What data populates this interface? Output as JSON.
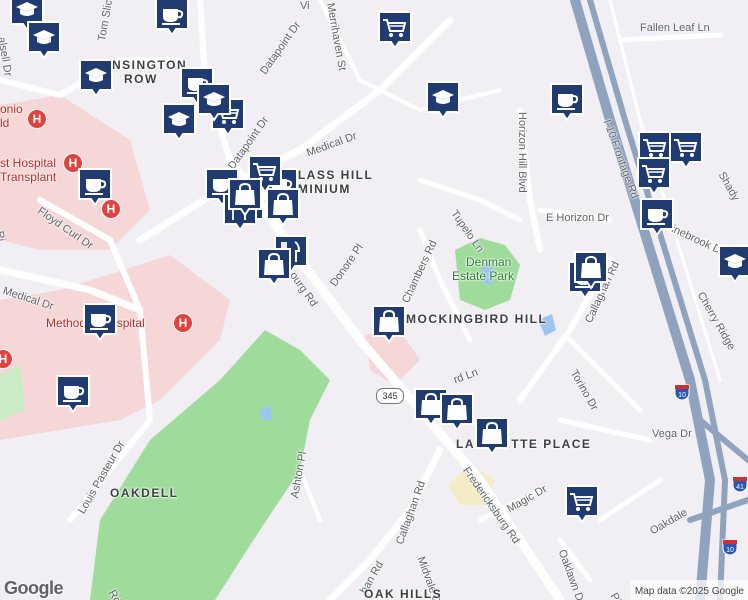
{
  "map": {
    "attribution": "Map data ©2025 Google",
    "logo_text": "Google",
    "colors": {
      "background": "#f1eff3",
      "park": "#9fdc9b",
      "medical": "#f6d7d7",
      "road": "#ffffff",
      "highway": "#8fa3bf",
      "water": "#9cc5f0",
      "pin": "#1f3b6f"
    },
    "street_labels": [
      {
        "text": "Tom Slick",
        "name": "street-tom-slick"
      },
      {
        "text": "Datapoint Dr",
        "name": "street-datapoint-dr"
      },
      {
        "text": "Medical Dr",
        "name": "street-medical-dr-east"
      },
      {
        "text": "Datapoint Dr",
        "name": "street-datapoint-dr-south"
      },
      {
        "text": "Floyd Curl Dr",
        "name": "street-floyd-curl-dr"
      },
      {
        "text": "Medical Dr",
        "name": "street-medical-dr-west"
      },
      {
        "text": "Donore Pl",
        "name": "street-donore-pl"
      },
      {
        "text": "Chambers Rd",
        "name": "street-chambers-rd"
      },
      {
        "text": "Tupelo Ln",
        "name": "street-tupelo-ln"
      },
      {
        "text": "Horizon Hill Blvd",
        "name": "street-horizon-hill-blvd"
      },
      {
        "text": "E Horizon Dr",
        "name": "street-e-horizon-dr"
      },
      {
        "text": "Callaghan Rd",
        "name": "street-callaghan-rd-east"
      },
      {
        "text": "Torino Dr",
        "name": "street-torino-dr"
      },
      {
        "text": "Vega Dr",
        "name": "street-vega-dr"
      },
      {
        "text": "I-10 Frontage Rd",
        "name": "street-i10-frontage-rd"
      },
      {
        "text": "Fallen Leaf Ln",
        "name": "street-fallen-leaf-ln"
      },
      {
        "text": "Shady",
        "name": "street-shady"
      },
      {
        "text": "Pinebrook Dr",
        "name": "street-pinebrook-dr"
      },
      {
        "text": "Cherry Ridge",
        "name": "street-cherry-ridge"
      },
      {
        "text": "Louis Pasteur Dr",
        "name": "street-louis-pasteur-dr"
      },
      {
        "text": "Ashton Pl",
        "name": "street-ashton-pl"
      },
      {
        "text": "Callaghan Rd",
        "name": "street-callaghan-rd-south"
      },
      {
        "text": "Fredericksburg Rd",
        "name": "street-fredericksburg-rd"
      },
      {
        "text": "Midvale Dr",
        "name": "street-midvale-dr"
      },
      {
        "text": "Magic Dr",
        "name": "street-magic-dr"
      },
      {
        "text": "Oakdale",
        "name": "street-oakdale"
      },
      {
        "text": "Oaklawn Dr",
        "name": "street-oaklawn-dr"
      },
      {
        "text": "Pin",
        "name": "street-pin"
      },
      {
        "text": "ourg Rd",
        "name": "street-fredericksburg-rd-north"
      },
      {
        "text": "Merrihaven St",
        "name": "street-merrihaven-st"
      },
      {
        "text": "Ri",
        "name": "street-rd-west"
      },
      {
        "text": "Vi",
        "name": "street-vi"
      },
      {
        "text": "rd Ln",
        "name": "street-bird-ln"
      },
      {
        "text": "han Rd",
        "name": "street-callaghan-rd-sw"
      },
      {
        "text": "alsell Dr",
        "name": "street-halsell-dr"
      },
      {
        "text": "Rd",
        "name": "street-rd-southwest"
      }
    ],
    "area_labels": [
      {
        "text": "NSINGTON",
        "name": "area-kensington"
      },
      {
        "text": "ROW",
        "name": "area-row"
      },
      {
        "text": "GLASS HILL",
        "name": "area-glass-hill"
      },
      {
        "text": "OMINIUM",
        "name": "area-condominium"
      },
      {
        "text": "MOCKINGBIRD HILL",
        "name": "area-mockingbird-hill"
      },
      {
        "text": "LAFAYETTE PLACE",
        "name": "area-lafayette-place"
      },
      {
        "text": "OAKDELL",
        "name": "area-oakdell"
      },
      {
        "text": "OAK HILLS",
        "name": "area-oak-hills"
      }
    ],
    "park_labels": [
      {
        "text": "Denman",
        "name": "park-denman"
      },
      {
        "text": "Estate Park",
        "name": "park-estate-park"
      }
    ],
    "hospital_labels": [
      {
        "text": "onio",
        "name": "hospital-antonio"
      },
      {
        "text": "ld",
        "name": "hospital-ld"
      },
      {
        "text": "st Hospital",
        "name": "hospital-methodist-north"
      },
      {
        "text": "Transplant",
        "name": "hospital-transplant"
      },
      {
        "text": "Methodist Hospital",
        "name": "hospital-methodist"
      }
    ],
    "highway_shields": [
      {
        "text": "345",
        "name": "shield-345"
      }
    ],
    "interstate_shields": [
      {
        "text": "10",
        "name": "interstate-10-a"
      },
      {
        "text": "10",
        "name": "interstate-10-b"
      },
      {
        "text": "41",
        "name": "interstate-41"
      }
    ],
    "markers": [
      {
        "icon": "school-icon"
      },
      {
        "icon": "school-icon"
      },
      {
        "icon": "school-icon"
      },
      {
        "icon": "school-icon"
      },
      {
        "icon": "school-icon"
      },
      {
        "icon": "school-icon"
      },
      {
        "icon": "coffee-icon"
      },
      {
        "icon": "coffee-icon"
      },
      {
        "icon": "coffee-icon"
      },
      {
        "icon": "coffee-icon"
      },
      {
        "icon": "coffee-icon"
      },
      {
        "icon": "coffee-icon"
      },
      {
        "icon": "coffee-icon"
      },
      {
        "icon": "coffee-icon"
      },
      {
        "icon": "coffee-icon"
      },
      {
        "icon": "coffee-icon"
      },
      {
        "icon": "cart-icon"
      },
      {
        "icon": "cart-icon"
      },
      {
        "icon": "cart-icon"
      },
      {
        "icon": "cart-icon"
      },
      {
        "icon": "cart-icon"
      },
      {
        "icon": "cart-icon"
      },
      {
        "icon": "cart-icon"
      },
      {
        "icon": "restaurant-icon"
      },
      {
        "icon": "restaurant-icon"
      },
      {
        "icon": "restaurant-icon"
      },
      {
        "icon": "shopping-bag-icon"
      },
      {
        "icon": "shopping-bag-icon"
      },
      {
        "icon": "shopping-bag-icon"
      },
      {
        "icon": "shopping-bag-icon"
      },
      {
        "icon": "shopping-bag-icon"
      },
      {
        "icon": "shopping-bag-icon"
      },
      {
        "icon": "shopping-bag-icon"
      },
      {
        "icon": "shopping-bag-icon"
      },
      {
        "icon": "school-icon"
      }
    ]
  }
}
